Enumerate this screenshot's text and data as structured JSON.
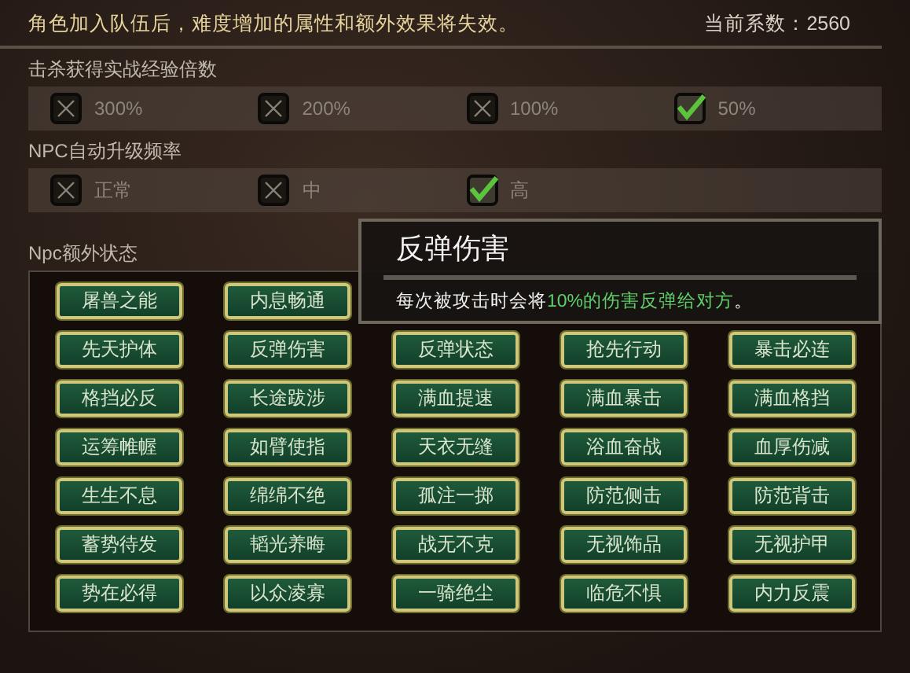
{
  "notice": "角色加入队伍后，难度增加的属性和额外效果将失效。",
  "coefficient": "当前系数：2560",
  "sections": [
    {
      "title": "击杀获得实战经验倍数",
      "options": [
        {
          "label": "300%",
          "checked": false
        },
        {
          "label": "200%",
          "checked": false
        },
        {
          "label": "100%",
          "checked": false
        },
        {
          "label": "50%",
          "checked": true
        }
      ]
    },
    {
      "title": "NPC自动升级频率",
      "options": [
        {
          "label": "正常",
          "checked": false
        },
        {
          "label": "中",
          "checked": false
        },
        {
          "label": "高",
          "checked": true
        }
      ]
    }
  ],
  "status_section": {
    "title": "Npc额外状态",
    "buttons": [
      "屠兽之能",
      "内息畅通",
      "先天护体",
      "反弹伤害",
      "反弹状态",
      "抢先行动",
      "暴击必连",
      "格挡必反",
      "长途跋涉",
      "满血提速",
      "满血暴击",
      "满血格挡",
      "运筹帷幄",
      "如臂使指",
      "天衣无缝",
      "浴血奋战",
      "血厚伤减",
      "生生不息",
      "绵绵不绝",
      "孤注一掷",
      "防范侧击",
      "防范背击",
      "蓄势待发",
      "韬光养晦",
      "战无不克",
      "无视饰品",
      "无视护甲",
      "势在必得",
      "以众凌寡",
      "一骑绝尘",
      "临危不惧",
      "内力反震"
    ]
  },
  "tooltip": {
    "title": "反弹伤害",
    "text": "每次被攻击时会将**10%的伤害反弹给对方**。"
  }
}
